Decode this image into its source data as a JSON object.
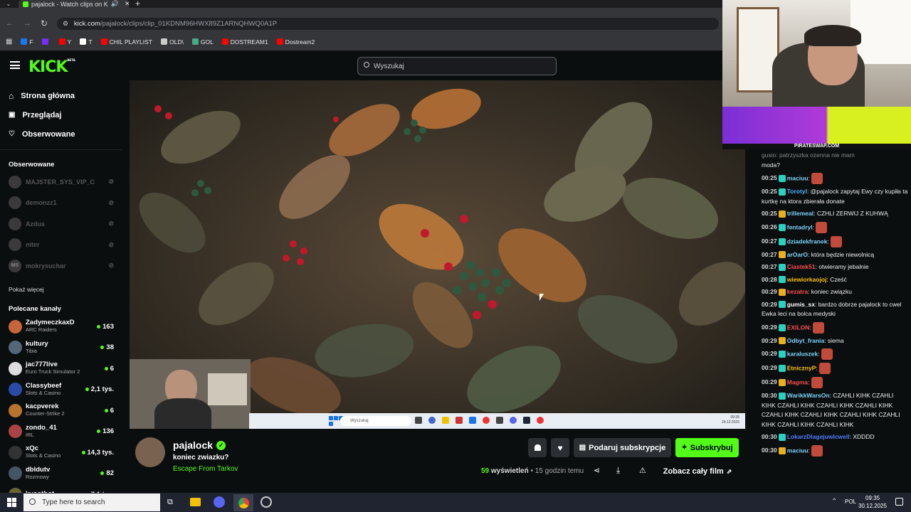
{
  "browser": {
    "tab_title": "pajalock - Watch clips on K",
    "url_domain": "kick.com",
    "url_path": "/pajalock/clips/clip_01KDNM96HWX89Z1ARNQHWQ0A1P",
    "bookmarks": [
      {
        "label": "F",
        "color": "#1877f2"
      },
      {
        "label": "",
        "color": "#7a2cff"
      },
      {
        "label": "Y",
        "color": "#ff0000"
      },
      {
        "label": "T",
        "color": "#ffffff"
      },
      {
        "label": "CHIL PLAYLIST",
        "color": "#ff0000"
      },
      {
        "label": "OLD\\",
        "color": "#cccccc"
      },
      {
        "label": "GOL",
        "color": "#44aa88"
      },
      {
        "label": "DOSTREAM1",
        "color": "#ff0000"
      },
      {
        "label": "Dostream2",
        "color": "#ff0000"
      }
    ]
  },
  "header": {
    "logo": "KICK",
    "logo_tag": "BETA",
    "search_placeholder": "Wyszukaj"
  },
  "sidebar": {
    "nav": [
      {
        "label": "Strona główna",
        "icon": "home-icon"
      },
      {
        "label": "Przeglądaj",
        "icon": "browse-icon"
      },
      {
        "label": "Obserwowane",
        "icon": "heart-icon"
      }
    ],
    "followed_title": "Obserwowane",
    "followed": [
      {
        "name": "MAJSTER_SYS_VIP_C"
      },
      {
        "name": "demonzz1"
      },
      {
        "name": "Azdus"
      },
      {
        "name": "niter"
      },
      {
        "name": "mokrysuchar",
        "initials": "MS"
      }
    ],
    "show_more": "Pokaż więcej",
    "recommended_title": "Polecane kanały",
    "recommended": [
      {
        "name": "ZadymeczkaxD",
        "category": "ARC Raiders",
        "viewers": "163",
        "color": "#c8643c"
      },
      {
        "name": "kultury",
        "category": "Tibia",
        "viewers": "38",
        "color": "#556677"
      },
      {
        "name": "jac777live",
        "category": "Euro Truck Simulator 2",
        "viewers": "6",
        "color": "#dddddd"
      },
      {
        "name": "Classybeef",
        "category": "Slots & Casino",
        "viewers": "2,1 tys.",
        "color": "#2a4aa8"
      },
      {
        "name": "kacpverek",
        "category": "Counter-Strike 2",
        "viewers": "6",
        "color": "#b8732d"
      },
      {
        "name": "zondo_41",
        "category": "IRL",
        "viewers": "136",
        "color": "#aa4444"
      },
      {
        "name": "xQc",
        "category": "Slots & Casino",
        "viewers": "14,3 tys.",
        "color": "#333333"
      },
      {
        "name": "dbldutv",
        "category": "Rozmowy",
        "viewers": "82",
        "color": "#445566"
      },
      {
        "name": "kvootbot",
        "category": "",
        "viewers": "7,1 tys.",
        "color": "#666633"
      }
    ]
  },
  "video": {
    "taskbar_search": "Wyszukaj",
    "taskbar_time": "09:35",
    "taskbar_date": "29.12.2025"
  },
  "clip": {
    "channel": "pajalock",
    "title": "koniec zwiazku?",
    "category": "Escape From Tarkov",
    "views": "59",
    "views_label": "wyświetleń",
    "age": "15 godzin temu",
    "gift_label": "Podaruj subskrypcje",
    "subscribe_label": "Subskrybuj",
    "full_video_label": "Zobacz cały film"
  },
  "overlay": {
    "banner_site": "PIRATESWAP.COM"
  },
  "chat": [
    {
      "time": "",
      "user": "",
      "color": "#ffffff",
      "text": "moda?",
      "cont": true,
      "partial": "gusio: patrzyszka ozenna nie mam"
    },
    {
      "time": "00:25",
      "user": "maciuu",
      "color": "#7dd3fc",
      "text": ""
    },
    {
      "time": "00:25",
      "user": "Torotyl",
      "color": "#4fb3ff",
      "text": "@pajalock zapytaj Ewy czy kupiła ta kurtkę na ktora zbierała donate"
    },
    {
      "time": "00:25",
      "user": "trillemeal",
      "color": "#7dd3fc",
      "text": "CZHLI ZERWIJ Z KUHWĄ"
    },
    {
      "time": "00:26",
      "user": "fentadryl",
      "color": "#7dd3fc",
      "text": ""
    },
    {
      "time": "00:27",
      "user": "dziadekfranek",
      "color": "#7dd3fc",
      "text": ""
    },
    {
      "time": "00:27",
      "user": "arOarO",
      "color": "#7dd3fc",
      "text": "która będzie niewolnicą"
    },
    {
      "time": "00:27",
      "user": "Ciastek51",
      "color": "#ff4f4f",
      "text": "otwieramy jebalnie"
    },
    {
      "time": "00:28",
      "user": "wiewiorkaojoj",
      "color": "#ffc107",
      "text": "Cześć"
    },
    {
      "time": "00:29",
      "user": "kezatra",
      "color": "#ff4f4f",
      "text": "koniec związku"
    },
    {
      "time": "00:29",
      "user": "gumis_sx",
      "color": "#ffffff",
      "text": "bardzo dobrze pajalock to cwel Ewka leci na bolca medyski"
    },
    {
      "time": "00:29",
      "user": "EXILON",
      "color": "#ff4f4f",
      "text": ""
    },
    {
      "time": "00:29",
      "user": "Odbyt_frania",
      "color": "#7dd3fc",
      "text": "siema"
    },
    {
      "time": "00:29",
      "user": "karaluszek",
      "color": "#7dd3fc",
      "text": ""
    },
    {
      "time": "00:29",
      "user": "EtnicznyP",
      "color": "#ffc107",
      "text": ""
    },
    {
      "time": "00:29",
      "user": "Magma",
      "color": "#ff4f4f",
      "text": ""
    },
    {
      "time": "00:30",
      "user": "WarikkWarsOn",
      "color": "#7dd3fc",
      "text": "CZAHLI KIHK CZAHLI KIHK CZAHLI KIHK CZAHLI KIHK CZAHLI KIHK CZAHLI KIHK CZAHLI KIHK CZAHLI KIHK CZAHLI KIHK CZAHLI KIHK CZAHLI KIHK"
    },
    {
      "time": "00:30",
      "user": "LokarzDlagejuwlcwell",
      "color": "#4f7dff",
      "text": "XDDDD"
    },
    {
      "time": "00:30",
      "user": "maciuu",
      "color": "#7dd3fc",
      "text": ""
    }
  ],
  "taskbar": {
    "search_placeholder": "Type here to search",
    "lang": "POL",
    "time": "09:35",
    "date": "30.12.2025"
  }
}
